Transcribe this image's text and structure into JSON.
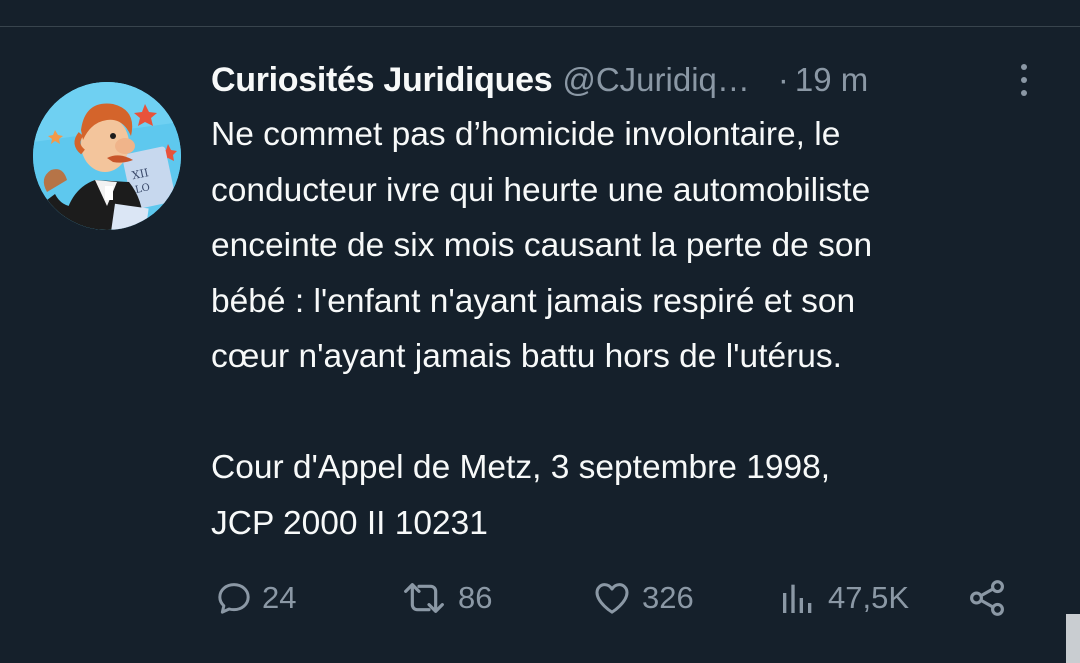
{
  "tweet": {
    "author": {
      "display_name": "Curiosités Juridiques",
      "handle": "@CJuridiq…",
      "avatar_icon": "cartoon-lawyer-avatar"
    },
    "separator": "·",
    "time": "19 m",
    "more_icon": "more-vertical-icon",
    "text": "Ne commet pas d’homicide involontaire, le\nconducteur ivre qui heurte une automobiliste\nenceinte de six mois causant la perte de son\nbébé : l'enfant n'ayant jamais respiré et son\ncœur n'ayant jamais battu hors de l'utérus.\n\nCour d'Appel de Metz, 3 septembre 1998,\nJCP 2000 II 10231",
    "actions": {
      "reply": {
        "icon": "reply-icon",
        "count": "24"
      },
      "retweet": {
        "icon": "retweet-icon",
        "count": "86"
      },
      "like": {
        "icon": "heart-icon",
        "count": "326"
      },
      "views": {
        "icon": "views-icon",
        "count": "47,5K"
      },
      "share": {
        "icon": "share-icon"
      }
    }
  },
  "colors": {
    "background": "#15202b",
    "primary_text": "#f7f9f9",
    "secondary_text": "#8b98a5",
    "divider": "#38444d"
  }
}
